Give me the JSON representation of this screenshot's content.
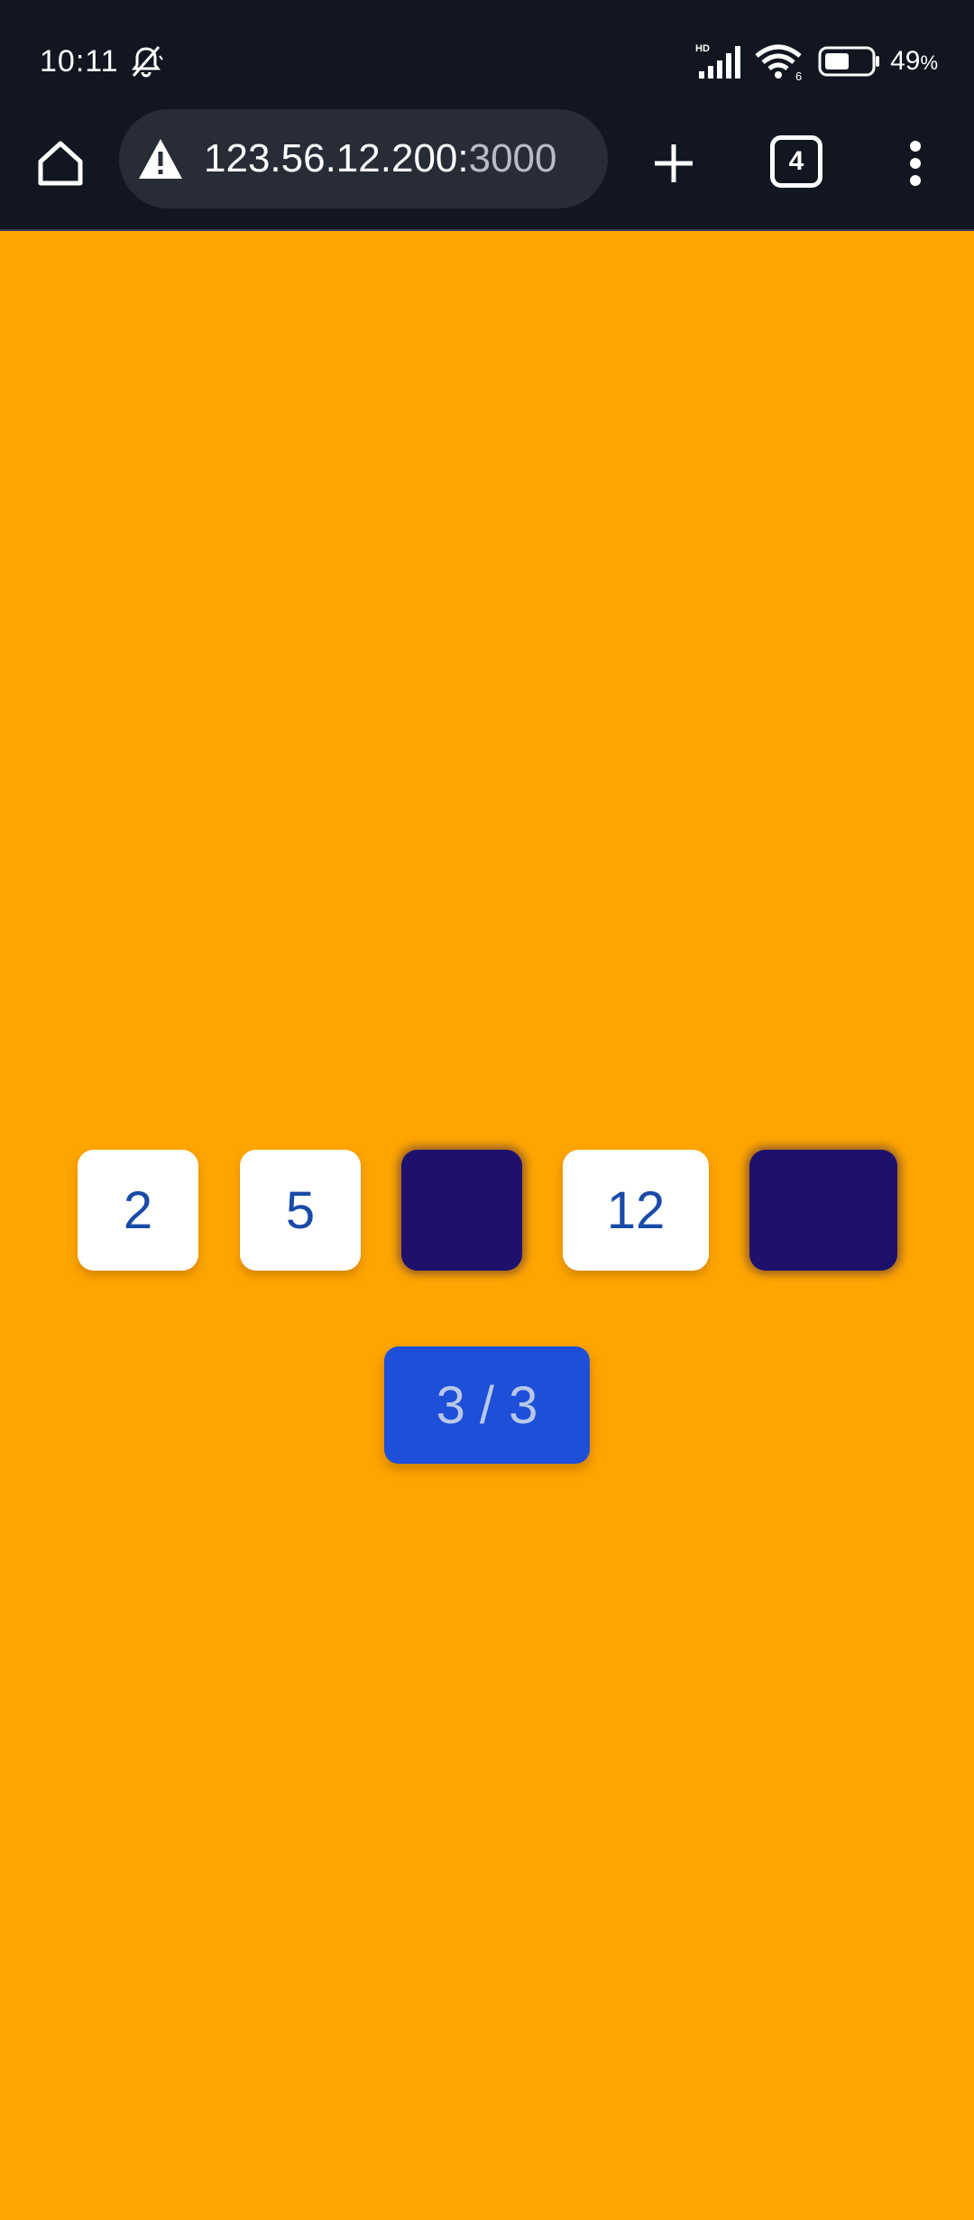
{
  "status_bar": {
    "time": "10:11",
    "battery_percent": "49",
    "battery_unit": "%",
    "network_label": "HD",
    "wifi_label": "6",
    "icons": [
      "mute-icon",
      "cellular-signal-icon",
      "wifi-icon",
      "battery-icon"
    ]
  },
  "browser": {
    "url_host": "123.56.12.200:",
    "url_port": "3000",
    "tab_count": "4",
    "icons": [
      "home-icon",
      "warning-icon",
      "plus-icon",
      "tab-switcher-icon",
      "more-vert-icon"
    ]
  },
  "game": {
    "tiles": [
      {
        "value": "2",
        "state": "revealed"
      },
      {
        "value": "5",
        "state": "revealed"
      },
      {
        "value": "",
        "state": "hidden"
      },
      {
        "value": "12",
        "state": "revealed"
      },
      {
        "value": "",
        "state": "hidden"
      }
    ],
    "progress_label": "3 / 3"
  },
  "colors": {
    "page_background": "#FFA500",
    "chrome_background": "#121620",
    "tile_revealed": "#FFFFFF",
    "tile_hidden": "#1E116C",
    "tile_text": "#1A4AA8",
    "button_background": "#1E4FD8"
  }
}
